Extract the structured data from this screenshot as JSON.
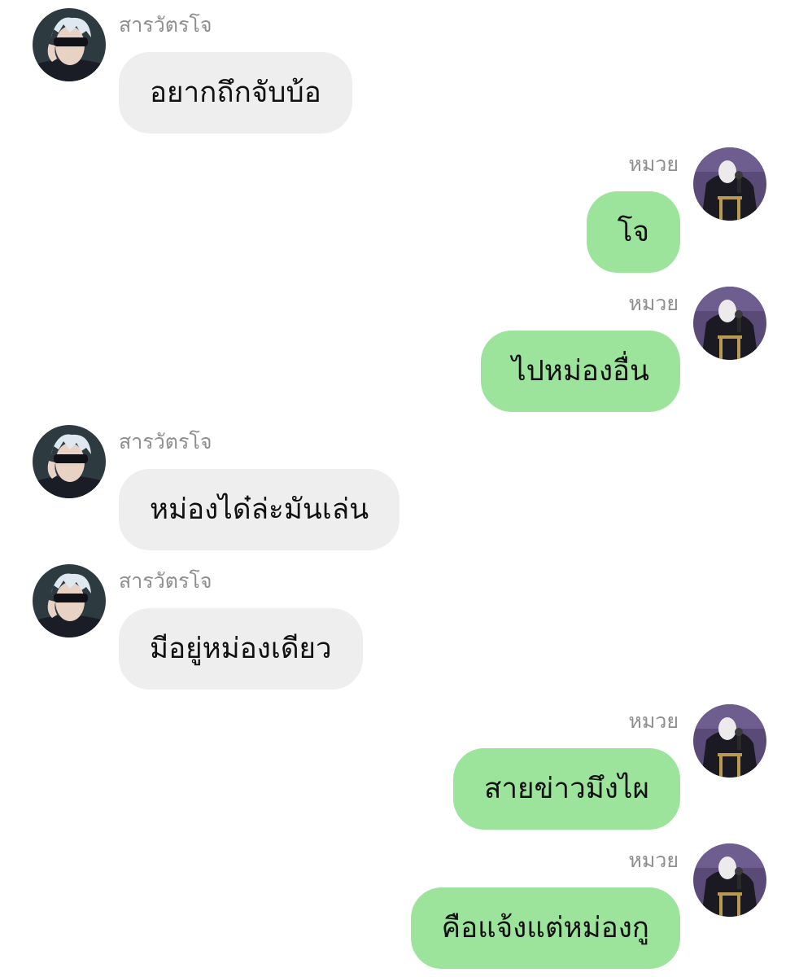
{
  "colors": {
    "incoming_bubble": "#eeeeee",
    "outgoing_bubble": "#9ce49c",
    "sender_name": "#8e8e8e",
    "message_text": "#111111",
    "background": "#ffffff"
  },
  "messages": [
    {
      "side": "left",
      "sender": "สารวัตรโจ",
      "text": "อยากถึกจับบ้อ"
    },
    {
      "side": "right",
      "sender": "หมวย",
      "text": "โจ"
    },
    {
      "side": "right",
      "sender": "หมวย",
      "text": "ไปหม่องอื่น"
    },
    {
      "side": "left",
      "sender": "สารวัตรโจ",
      "text": "หม่องได๋ล่ะมันเล่น"
    },
    {
      "side": "left",
      "sender": "สารวัตรโจ",
      "text": "มีอยู่หม่องเดียว"
    },
    {
      "side": "right",
      "sender": "หมวย",
      "text": "สายข่าวมึงไผ"
    },
    {
      "side": "right",
      "sender": "หมวย",
      "text": "คือแจ้งแต่หม่องกู"
    }
  ],
  "avatars": {
    "left": "blindfolded-white-haired-man-avatar",
    "right": "masked-figure-with-microphone-avatar"
  }
}
